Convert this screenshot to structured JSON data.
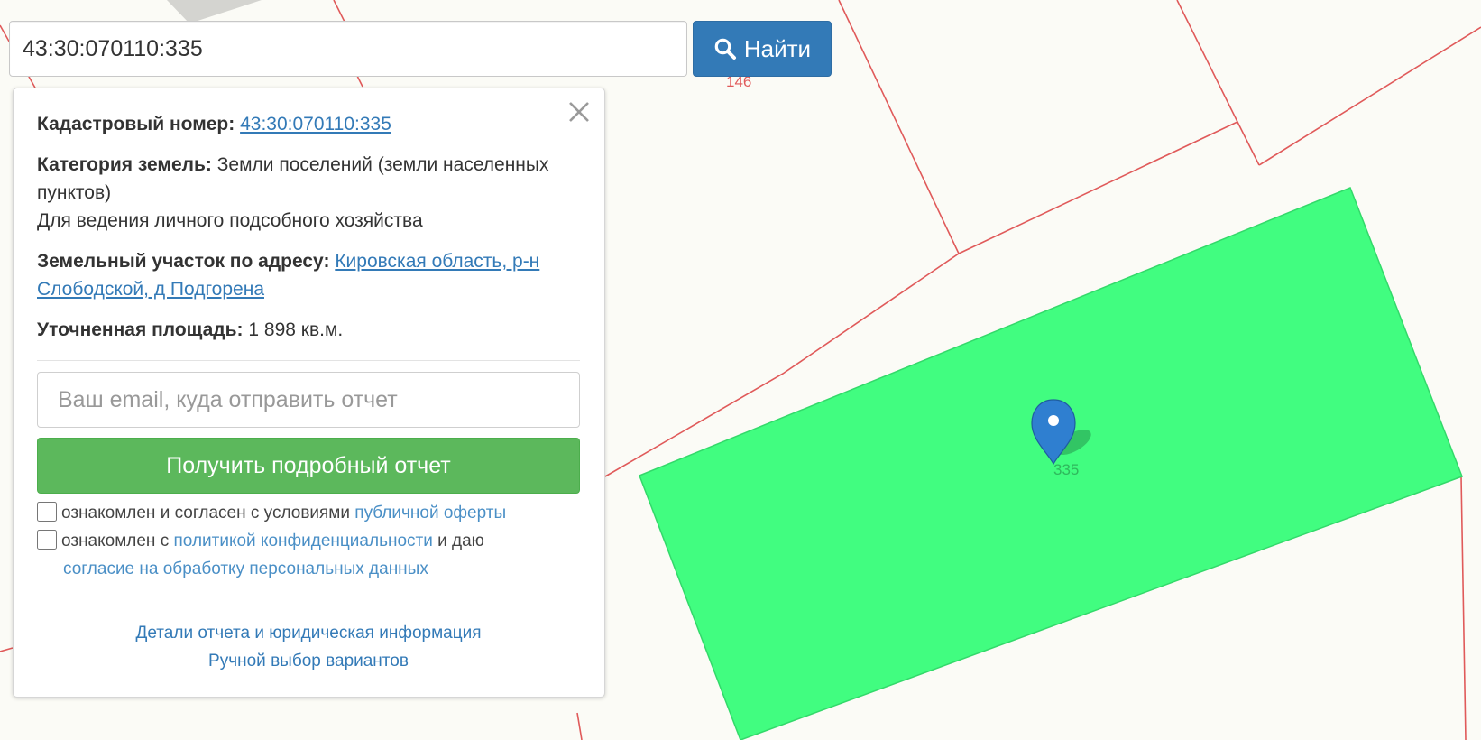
{
  "search": {
    "value": "43:30:070110:335",
    "button_label": "Найти"
  },
  "map": {
    "parcel_numbers": {
      "neighbor": "146",
      "selected": "335"
    },
    "colors": {
      "background": "#fbfbf6",
      "boundary": "#e05a5a",
      "selected_fill": "#41fd80",
      "marker": "#2f7fd0"
    }
  },
  "panel": {
    "cadastral": {
      "label": "Кадастровый номер:",
      "value": "43:30:070110:335"
    },
    "category": {
      "label": "Категория земель:",
      "value": "Земли поселений (земли населенных пунктов)",
      "usage": "Для ведения личного подсобного хозяйства"
    },
    "address": {
      "label": "Земельный участок по адресу:",
      "value": "Кировская область, р-н Слободской, д Подгорена"
    },
    "area": {
      "label": "Уточненная площадь:",
      "value": "1 898 кв.м."
    },
    "email": {
      "placeholder": "Ваш email, куда отправить отчет"
    },
    "report_button": "Получить подробный отчет",
    "consent1": {
      "text": "ознакомлен и согласен с условиями",
      "link": "публичной оферты"
    },
    "consent2": {
      "text_before": "ознакомлен с",
      "link1": "политикой конфиденциальности",
      "text_middle": "и даю",
      "link2": "согласие на обработку персональных данных"
    },
    "footer": {
      "details_link": "Детали отчета и юридическая информация",
      "manual_link": "Ручной выбор вариантов"
    }
  }
}
